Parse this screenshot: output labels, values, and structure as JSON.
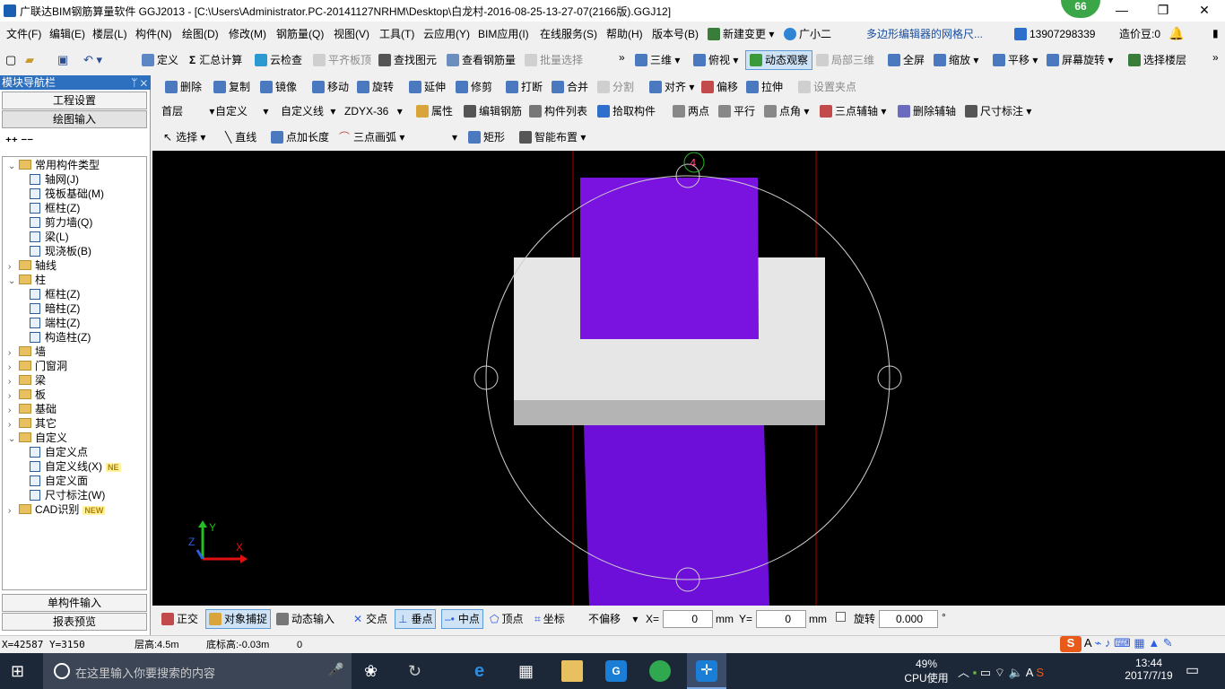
{
  "window": {
    "title": "广联达BIM钢筋算量软件 GGJ2013 - [C:\\Users\\Administrator.PC-20141127NRHM\\Desktop\\白龙村-2016-08-25-13-27-07(2166版).GGJ12]",
    "badge": "66",
    "min": "—",
    "max": "❐",
    "close": "✕"
  },
  "menu": [
    "文件(F)",
    "编辑(E)",
    "楼层(L)",
    "构件(N)",
    "绘图(D)",
    "修改(M)",
    "钢筋量(Q)",
    "视图(V)",
    "工具(T)",
    "云应用(Y)",
    "BIM应用(I)",
    "在线服务(S)",
    "帮助(H)",
    "版本号(B)",
    "新建变更 ▾",
    "广小二"
  ],
  "menu_right": {
    "notice": "多边形编辑器的网格尺...",
    "phone": "13907298339",
    "coins": "造价豆:0"
  },
  "toolbar1": [
    "定义",
    "汇总计算",
    "云检查",
    "平齐板顶",
    "查找图元",
    "查看钢筋量",
    "批量选择",
    "三维 ▾",
    "俯视 ▾",
    "动态观察",
    "局部三维",
    "全屏",
    "缩放 ▾",
    "平移 ▾",
    "屏幕旋转 ▾",
    "选择楼层"
  ],
  "toolbar2": [
    "删除",
    "复制",
    "镜像",
    "移动",
    "旋转",
    "延伸",
    "修剪",
    "打断",
    "合并",
    "分割",
    "对齐 ▾",
    "偏移",
    "拉伸",
    "设置夹点"
  ],
  "toolbar3": {
    "floor": "首层",
    "type": "自定义",
    "sub": "自定义线",
    "name": "ZDYX-36",
    "buttons": [
      "属性",
      "编辑钢筋",
      "构件列表",
      "拾取构件",
      "两点",
      "平行",
      "点角 ▾",
      "三点辅轴 ▾",
      "删除辅轴",
      "尺寸标注 ▾"
    ]
  },
  "toolbar4": [
    "选择 ▾",
    "直线",
    "点加长度",
    "三点画弧 ▾",
    "矩形",
    "智能布置 ▾"
  ],
  "sidebar": {
    "header": "模块导航栏",
    "pin": "ᛘ ✕",
    "btn_project": "工程设置",
    "btn_draw": "绘图输入",
    "btn_single": "单构件输入",
    "btn_report": "报表预览",
    "tree": [
      {
        "label": "常用构件类型",
        "level": 0,
        "kind": "folder",
        "exp": "⌄"
      },
      {
        "label": "轴网(J)",
        "level": 1,
        "kind": "item"
      },
      {
        "label": "筏板基础(M)",
        "level": 1,
        "kind": "item"
      },
      {
        "label": "框柱(Z)",
        "level": 1,
        "kind": "item"
      },
      {
        "label": "剪力墙(Q)",
        "level": 1,
        "kind": "item"
      },
      {
        "label": "梁(L)",
        "level": 1,
        "kind": "item"
      },
      {
        "label": "现浇板(B)",
        "level": 1,
        "kind": "item"
      },
      {
        "label": "轴线",
        "level": 0,
        "kind": "folder",
        "exp": "›"
      },
      {
        "label": "柱",
        "level": 0,
        "kind": "folder",
        "exp": "⌄"
      },
      {
        "label": "框柱(Z)",
        "level": 1,
        "kind": "item"
      },
      {
        "label": "暗柱(Z)",
        "level": 1,
        "kind": "item"
      },
      {
        "label": "端柱(Z)",
        "level": 1,
        "kind": "item"
      },
      {
        "label": "构造柱(Z)",
        "level": 1,
        "kind": "item"
      },
      {
        "label": "墙",
        "level": 0,
        "kind": "folder",
        "exp": "›"
      },
      {
        "label": "门窗洞",
        "level": 0,
        "kind": "folder",
        "exp": "›"
      },
      {
        "label": "梁",
        "level": 0,
        "kind": "folder",
        "exp": "›"
      },
      {
        "label": "板",
        "level": 0,
        "kind": "folder",
        "exp": "›"
      },
      {
        "label": "基础",
        "level": 0,
        "kind": "folder",
        "exp": "›"
      },
      {
        "label": "其它",
        "level": 0,
        "kind": "folder",
        "exp": "›"
      },
      {
        "label": "自定义",
        "level": 0,
        "kind": "folder",
        "exp": "⌄"
      },
      {
        "label": "自定义点",
        "level": 1,
        "kind": "item"
      },
      {
        "label": "自定义线(X)",
        "level": 1,
        "kind": "item",
        "tag": "NE"
      },
      {
        "label": "自定义面",
        "level": 1,
        "kind": "item"
      },
      {
        "label": "尺寸标注(W)",
        "level": 1,
        "kind": "item"
      },
      {
        "label": "CAD识别",
        "level": 0,
        "kind": "folder",
        "exp": "›",
        "tag": "NEW"
      }
    ]
  },
  "canvas": {
    "axis_label": "4",
    "axis_x": "X",
    "axis_y": "Y",
    "axis_z": "Z",
    "colors": {
      "purple": "#7a12e0",
      "slab": "#e6e6e6",
      "slab_side": "#b4b4b4",
      "red_line": "#b00000"
    }
  },
  "snapbar": {
    "items": [
      "正交",
      "对象捕捉",
      "动态输入",
      "交点",
      "垂点",
      "中点",
      "顶点",
      "坐标"
    ],
    "offset": "不偏移",
    "x_label": "X=",
    "x_val": "0",
    "y_label": "Y=",
    "y_val": "0",
    "unit": "mm",
    "rotate_label": "旋转",
    "rotate_val": "0.000",
    "deg": "°"
  },
  "status": {
    "coords": "X=42587 Y=3150",
    "floor_h": "层高:4.5m",
    "base_h": "底标高:-0.03m",
    "val": "0"
  },
  "taskbar": {
    "search": "在这里输入你要搜索的内容",
    "cpu_pct": "49%",
    "cpu_label": "CPU使用",
    "time": "13:44",
    "date": "2017/7/19",
    "ime": "A"
  }
}
